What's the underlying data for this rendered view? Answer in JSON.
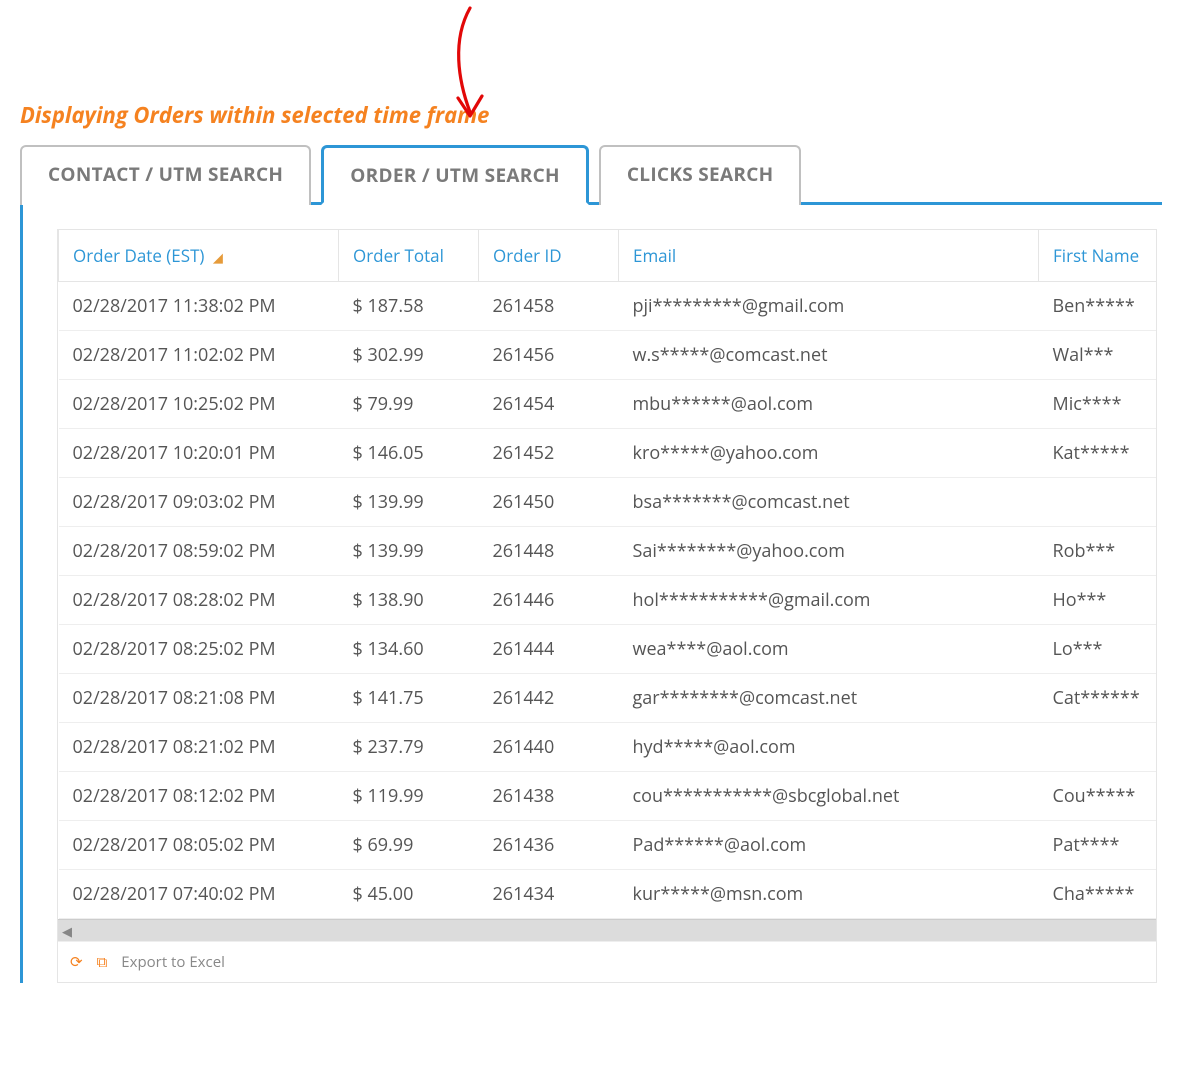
{
  "heading": "Displaying Orders within selected time frame",
  "tabs": [
    {
      "label": "CONTACT / UTM SEARCH",
      "active": false
    },
    {
      "label": "ORDER / UTM SEARCH",
      "active": true
    },
    {
      "label": "CLICKS SEARCH",
      "active": false
    }
  ],
  "grid": {
    "columns": {
      "order_date": "Order Date (EST)",
      "order_total": "Order Total",
      "order_id": "Order ID",
      "email": "Email",
      "first_name": "First Name"
    },
    "sort_column": "order_date",
    "rows": [
      {
        "order_date": "02/28/2017 11:38:02 PM",
        "order_total": "$ 187.58",
        "order_id": "261458",
        "email": "pji*********@gmail.com",
        "first_name": "Ben*****"
      },
      {
        "order_date": "02/28/2017 11:02:02 PM",
        "order_total": "$ 302.99",
        "order_id": "261456",
        "email": "w.s*****@comcast.net",
        "first_name": "Wal***"
      },
      {
        "order_date": "02/28/2017 10:25:02 PM",
        "order_total": "$ 79.99",
        "order_id": "261454",
        "email": "mbu******@aol.com",
        "first_name": "Mic****"
      },
      {
        "order_date": "02/28/2017 10:20:01 PM",
        "order_total": "$ 146.05",
        "order_id": "261452",
        "email": "kro*****@yahoo.com",
        "first_name": "Kat*****"
      },
      {
        "order_date": "02/28/2017 09:03:02 PM",
        "order_total": "$ 139.99",
        "order_id": "261450",
        "email": "bsa*******@comcast.net",
        "first_name": ""
      },
      {
        "order_date": "02/28/2017 08:59:02 PM",
        "order_total": "$ 139.99",
        "order_id": "261448",
        "email": "Sai********@yahoo.com",
        "first_name": "Rob***"
      },
      {
        "order_date": "02/28/2017 08:28:02 PM",
        "order_total": "$ 138.90",
        "order_id": "261446",
        "email": "hol***********@gmail.com",
        "first_name": "Ho***"
      },
      {
        "order_date": "02/28/2017 08:25:02 PM",
        "order_total": "$ 134.60",
        "order_id": "261444",
        "email": "wea****@aol.com",
        "first_name": "Lo***"
      },
      {
        "order_date": "02/28/2017 08:21:08 PM",
        "order_total": "$ 141.75",
        "order_id": "261442",
        "email": "gar********@comcast.net",
        "first_name": "Cat******"
      },
      {
        "order_date": "02/28/2017 08:21:02 PM",
        "order_total": "$ 237.79",
        "order_id": "261440",
        "email": "hyd*****@aol.com",
        "first_name": ""
      },
      {
        "order_date": "02/28/2017 08:12:02 PM",
        "order_total": "$ 119.99",
        "order_id": "261438",
        "email": "cou***********@sbcglobal.net",
        "first_name": "Cou*****"
      },
      {
        "order_date": "02/28/2017 08:05:02 PM",
        "order_total": "$ 69.99",
        "order_id": "261436",
        "email": "Pad******@aol.com",
        "first_name": "Pat****"
      },
      {
        "order_date": "02/28/2017 07:40:02 PM",
        "order_total": "$ 45.00",
        "order_id": "261434",
        "email": "kur*****@msn.com",
        "first_name": "Cha*****"
      }
    ],
    "footer": {
      "export_label": "Export to Excel"
    }
  }
}
